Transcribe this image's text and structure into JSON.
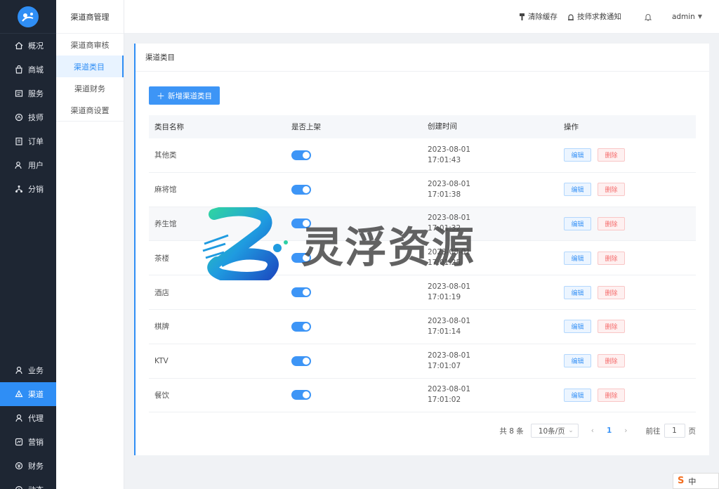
{
  "nav": {
    "top_items": [
      {
        "label": "概况",
        "icon": "home-icon"
      },
      {
        "label": "商城",
        "icon": "shop-icon"
      },
      {
        "label": "服务",
        "icon": "service-icon"
      },
      {
        "label": "技师",
        "icon": "technician-icon"
      },
      {
        "label": "订单",
        "icon": "order-icon"
      },
      {
        "label": "用户",
        "icon": "user-icon"
      },
      {
        "label": "分销",
        "icon": "distribution-icon"
      }
    ],
    "bottom_items": [
      {
        "label": "业务",
        "icon": "business-icon"
      },
      {
        "label": "渠道",
        "icon": "channel-icon"
      },
      {
        "label": "代理",
        "icon": "agent-icon"
      },
      {
        "label": "营销",
        "icon": "marketing-icon"
      },
      {
        "label": "财务",
        "icon": "finance-icon"
      },
      {
        "label": "动态",
        "icon": "dynamic-icon"
      }
    ],
    "active": "渠道"
  },
  "subnav": {
    "title": "渠道商管理",
    "items": [
      "渠道商审核",
      "渠道类目",
      "渠道财务",
      "渠道商设置"
    ],
    "active": "渠道类目"
  },
  "header": {
    "clear_cache": "清除缓存",
    "tech_notice": "技师求救通知",
    "user": "admin"
  },
  "panel": {
    "title": "渠道类目",
    "add_button": "新增渠道类目"
  },
  "table": {
    "headers": [
      "类目名称",
      "是否上架",
      "创建时间",
      "操作"
    ],
    "rows": [
      {
        "name": "其他类",
        "listed": true,
        "date": "2023-08-01",
        "time": "17:01:43"
      },
      {
        "name": "麻将馆",
        "listed": true,
        "date": "2023-08-01",
        "time": "17:01:38"
      },
      {
        "name": "养生馆",
        "listed": true,
        "date": "2023-08-01",
        "time": "17:01:32"
      },
      {
        "name": "茶楼",
        "listed": true,
        "date": "2023-08-01",
        "time": "17:01:25"
      },
      {
        "name": "酒店",
        "listed": true,
        "date": "2023-08-01",
        "time": "17:01:19"
      },
      {
        "name": "棋牌",
        "listed": true,
        "date": "2023-08-01",
        "time": "17:01:14"
      },
      {
        "name": "KTV",
        "listed": true,
        "date": "2023-08-01",
        "time": "17:01:07"
      },
      {
        "name": "餐饮",
        "listed": true,
        "date": "2023-08-01",
        "time": "17:01:02"
      }
    ],
    "edit_label": "编辑",
    "delete_label": "删除"
  },
  "pagination": {
    "total": "共 8 条",
    "page_size": "10条/页",
    "current_page": "1",
    "goto_label": "前往",
    "goto_value": "1",
    "page_suffix": "页"
  },
  "watermark": {
    "text": "灵浮资源"
  },
  "ime": {
    "label": "中"
  },
  "colors": {
    "accent": "#3d95f6",
    "nav_bg": "#1e2633",
    "danger": "#f56c6c"
  }
}
